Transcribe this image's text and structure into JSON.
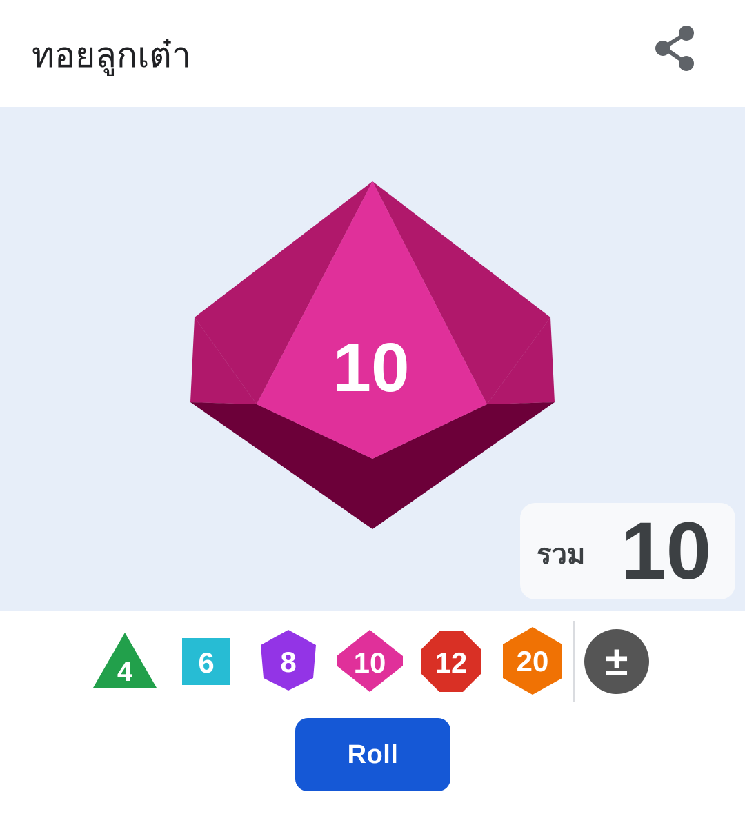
{
  "header": {
    "title": "ทอยลูกเต๋า",
    "share_icon": "share-icon"
  },
  "result": {
    "die_value": "10",
    "die_type": "d10",
    "die_color": "#e0309a",
    "total_label": "รวม",
    "total_value": "10"
  },
  "dice": [
    {
      "label": "4",
      "shape": "triangle",
      "color": "#22a04b"
    },
    {
      "label": "6",
      "shape": "square",
      "color": "#27bcd4"
    },
    {
      "label": "8",
      "shape": "hexagon",
      "color": "#9334e6"
    },
    {
      "label": "10",
      "shape": "diamond",
      "color": "#e0309a"
    },
    {
      "label": "12",
      "shape": "octagon",
      "color": "#d93025"
    },
    {
      "label": "20",
      "shape": "hexagon",
      "color": "#f07204"
    }
  ],
  "modifier": {
    "label": "±",
    "color": "#555555",
    "icon": "plus-minus-icon"
  },
  "roll_button": {
    "label": "Roll",
    "color": "#1558d6"
  }
}
